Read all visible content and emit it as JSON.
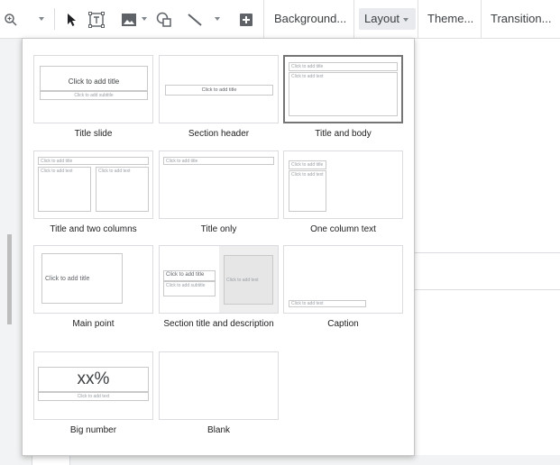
{
  "toolbar": {
    "background_label": "Background...",
    "layout_label": "Layout",
    "theme_label": "Theme...",
    "transition_label": "Transition..."
  },
  "layouts": [
    {
      "label": "Title slide",
      "title_text": "Click to add title",
      "subtitle_text": "Click to add subtitle"
    },
    {
      "label": "Section header",
      "title_text": "Click to add title"
    },
    {
      "label": "Title and body",
      "title_text": "Click to add title",
      "body_text": "Click to add text"
    },
    {
      "label": "Title and two columns",
      "title_text": "Click to add title",
      "col1_text": "Click to add text",
      "col2_text": "Click to add text"
    },
    {
      "label": "Title only",
      "title_text": "Click to add title"
    },
    {
      "label": "One column text",
      "title_text": "Click to add title",
      "body_text": "Click to add text"
    },
    {
      "label": "Main point",
      "title_text": "Click to add title"
    },
    {
      "label": "Section title and description",
      "title_text": "Click to add title",
      "subtitle_text": "Click to add subtitle",
      "body_text": "Click to add text"
    },
    {
      "label": "Caption",
      "caption_text": "Click to add text"
    },
    {
      "label": "Big number",
      "number_text": "xx%",
      "body_text": "Click to add text"
    },
    {
      "label": "Blank"
    }
  ],
  "selected_layout": "Title and body",
  "colors": {
    "toolbar_active": "#e8eaed",
    "selected_border": "#757575",
    "background": "#f1f3f4"
  }
}
